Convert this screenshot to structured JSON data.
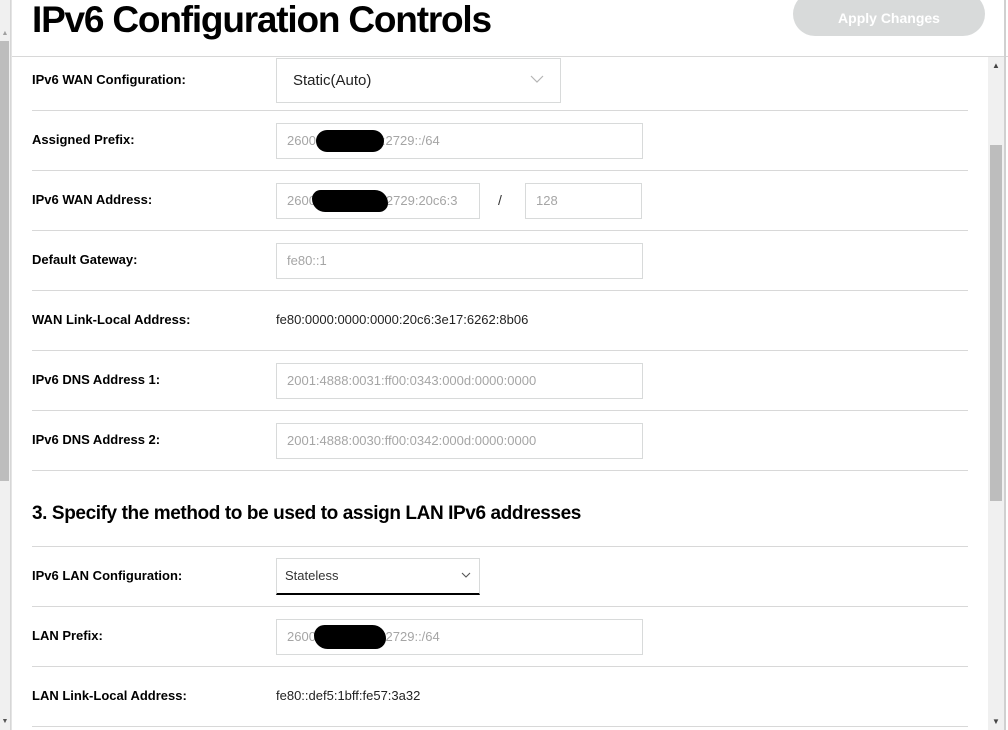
{
  "header": {
    "title": "IPv6 Configuration Controls",
    "apply_label": "Apply Changes"
  },
  "wan": {
    "configuration": {
      "label": "IPv6 WAN Configuration:",
      "value": "Static(Auto)",
      "icon": "chevron-down-icon"
    },
    "assigned_prefix": {
      "label": "Assigned Prefix:",
      "value_start": "2600",
      "value_end": ":2729::/64",
      "redacted": true
    },
    "wan_address": {
      "label": "IPv6 WAN Address:",
      "value_start": "2600",
      "value_end": "2729:20c6:3",
      "redacted": true,
      "separator": "/",
      "prefix_length": "128"
    },
    "default_gateway": {
      "label": "Default Gateway:",
      "value": "fe80::1"
    },
    "wan_link_local": {
      "label": "WAN Link-Local Address:",
      "value": "fe80:0000:0000:0000:20c6:3e17:6262:8b06"
    },
    "dns1": {
      "label": "IPv6 DNS Address 1:",
      "value": "2001:4888:0031:ff00:0343:000d:0000:0000"
    },
    "dns2": {
      "label": "IPv6 DNS Address 2:",
      "value": "2001:4888:0030:ff00:0342:000d:0000:0000"
    }
  },
  "lan_section": {
    "title": "3. Specify the method to be used to assign LAN IPv6 addresses",
    "configuration": {
      "label": "IPv6 LAN Configuration:",
      "value": "Stateless",
      "icon": "chevron-down-icon"
    },
    "lan_prefix": {
      "label": "LAN Prefix:",
      "value_start": "2600",
      "value_end": ":2729::/64",
      "redacted": true
    },
    "lan_link_local": {
      "label": "LAN Link-Local Address:",
      "value": "fe80::def5:1bff:fe57:3a32"
    }
  },
  "colors": {
    "apply_button_bg": "#d8dada",
    "field_border": "#d8dada",
    "divider": "#d8d8d8",
    "disabled_text": "#a5a5a5"
  }
}
